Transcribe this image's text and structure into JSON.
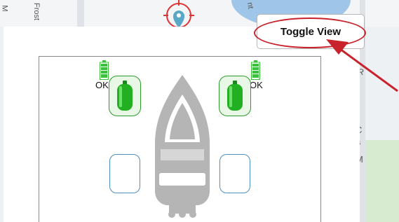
{
  "map": {
    "street_left": "Frost",
    "street_right": "nt",
    "side_letter_1": "R",
    "side_letter_2": "C",
    "side_letter_3": "a",
    "side_letter_4": "M",
    "top_left_letter": "M"
  },
  "toolbar": {
    "toggle_label": "Toggle View"
  },
  "sensors": [
    {
      "id": "left",
      "status": "OK",
      "battery_level": 1.0
    },
    {
      "id": "right",
      "status": "OK",
      "battery_level": 1.0
    }
  ],
  "colors": {
    "sensor_green": "#22b022",
    "battery_green": "#3cbf3c",
    "slot_border": "#4f8fc0",
    "annotation_red": "#c8232c",
    "boat_gray": "#b5b5b5"
  }
}
